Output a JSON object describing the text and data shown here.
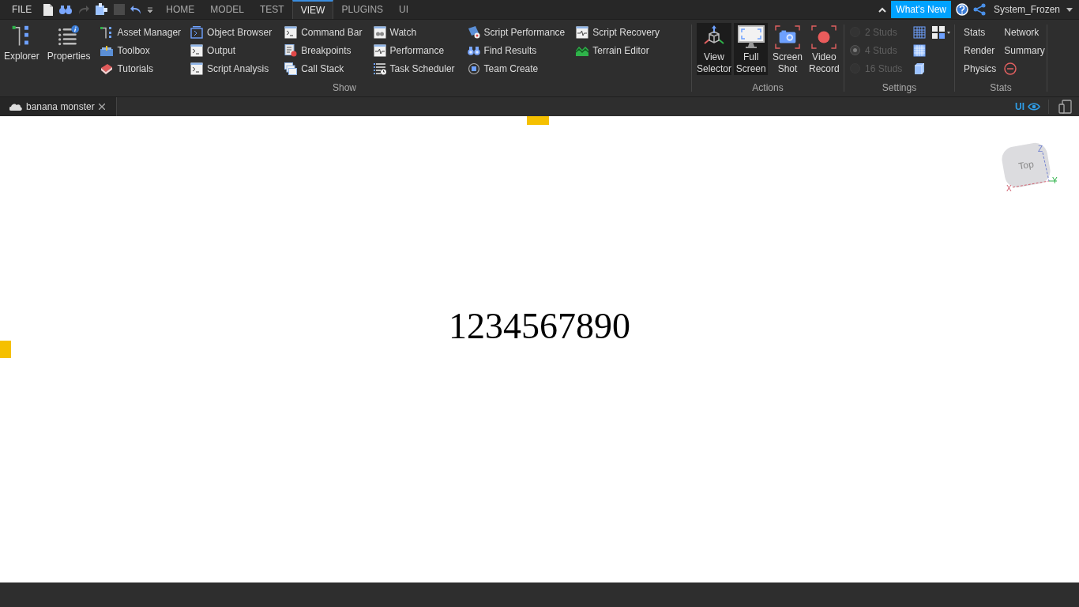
{
  "file_menu": "FILE",
  "tabs": [
    {
      "label": "HOME",
      "selected": false
    },
    {
      "label": "MODEL",
      "selected": false
    },
    {
      "label": "TEST",
      "selected": false
    },
    {
      "label": "VIEW",
      "selected": true
    },
    {
      "label": "PLUGINS",
      "selected": false
    },
    {
      "label": "UI",
      "selected": false
    }
  ],
  "whats_new": "What's New",
  "user": "System_Frozen",
  "show_group": {
    "label": "Show",
    "large_buttons": [
      "Explorer",
      "Properties"
    ],
    "columns": [
      [
        "Asset Manager",
        "Toolbox",
        "Tutorials"
      ],
      [
        "Object Browser",
        "Output",
        "Script Analysis"
      ],
      [
        "Command Bar",
        "Breakpoints",
        "Call Stack"
      ],
      [
        "Watch",
        "Performance",
        "Task Scheduler"
      ],
      [
        "Script Performance",
        "Find Results",
        "Team Create"
      ],
      [
        "Script Recovery",
        "Terrain Editor"
      ]
    ]
  },
  "actions_group": {
    "label": "Actions",
    "buttons": [
      {
        "label": "View Selector",
        "selected": true
      },
      {
        "label": "Full Screen",
        "selected": true
      },
      {
        "label": "Screen Shot",
        "selected": false
      },
      {
        "label": "Video Record",
        "selected": false
      }
    ]
  },
  "settings_group": {
    "label": "Settings",
    "grid_sizes": [
      {
        "label": "2 Studs",
        "selected": false,
        "disabled": true
      },
      {
        "label": "4 Studs",
        "selected": true,
        "disabled": true
      },
      {
        "label": "16 Studs",
        "selected": false,
        "disabled": true
      }
    ]
  },
  "stats_group": {
    "label": "Stats",
    "items": [
      "Stats",
      "Network",
      "Render",
      "Summary",
      "Physics"
    ]
  },
  "document_tab": {
    "label": "banana monster"
  },
  "ui_toggle": "UI",
  "viewport": {
    "text": "1234567890",
    "view_cube": {
      "face": "Top",
      "axes": [
        "X",
        "Y",
        "Z"
      ]
    }
  }
}
